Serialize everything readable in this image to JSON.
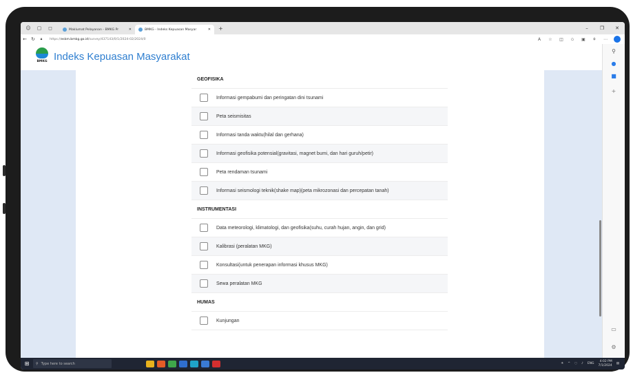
{
  "browser": {
    "tabs": [
      {
        "label": "Maklumat Pelayanan - BMKG Pr"
      },
      {
        "label": "BMKG - Indeks Kepuasan Masyar"
      }
    ],
    "url_prefix": "https://",
    "url_host": "eskm.bmkg.go.id",
    "url_path": "/survey/437143/0/1/2024-02/2024/0"
  },
  "header": {
    "logo_text": "BMKG",
    "title": "Indeks Kepuasan Masyarakat"
  },
  "form": {
    "sections": [
      {
        "title": "GEOFISIKA",
        "options": [
          "Informasi gempabumi dan peringatan dini tsunami",
          "Peta seismisitas",
          "Informasi tanda waktu(hilal dan gerhana)",
          "Informasi geofisika potensial(gravitasi, magnet bumi, dan hari guruh/petir)",
          "Peta rendaman tsunami",
          "Informasi seismologi teknik(shake map)(peta mikrozonasi dan percepatan tanah)"
        ]
      },
      {
        "title": "INSTRUMENTASI",
        "options": [
          "Data meteorologi, klimatologi, dan geofisika(suhu, curah hujan, angin, dan grid)",
          "Kalibrasi (peralatan MKG)",
          "Konsultasi(untuk penerapan informasi khusus MKG)",
          "Sewa peralatan MKG"
        ]
      },
      {
        "title": "HUMAS",
        "options": [
          "Kunjungan"
        ]
      }
    ]
  },
  "taskbar": {
    "search_placeholder": "Type here to search",
    "lang": "ENG",
    "time": "4:02 PM",
    "date": "7/1/2024"
  },
  "colors": {
    "accent": "#2f7fd0",
    "page_bg": "#dfe8f5",
    "taskbar": "#1f2533"
  }
}
